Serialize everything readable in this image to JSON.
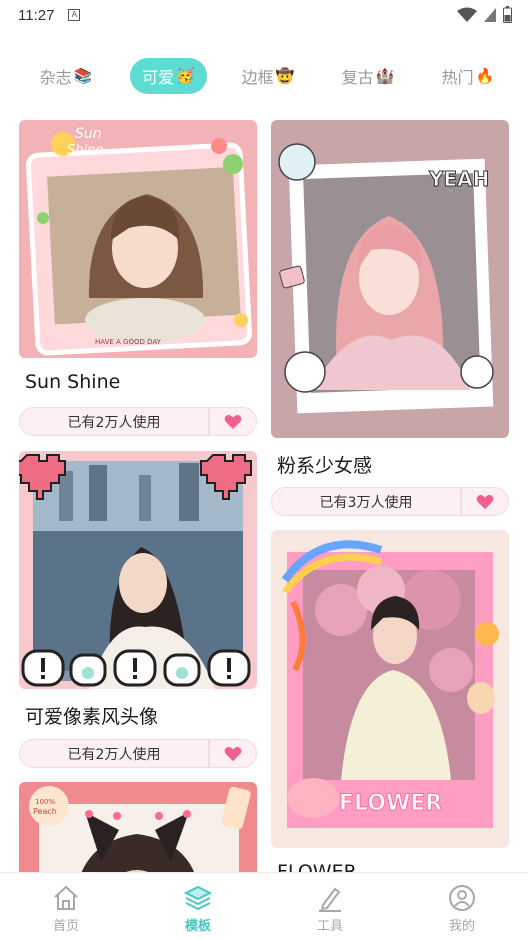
{
  "status_bar": {
    "time": "11:27",
    "notif_badge": "A"
  },
  "tabs": [
    {
      "label": "杂志",
      "emoji": "📚"
    },
    {
      "label": "可爱",
      "emoji": "🥳"
    },
    {
      "label": "边框",
      "emoji": "🤠"
    },
    {
      "label": "复古",
      "emoji": "🏰"
    },
    {
      "label": "热门",
      "emoji": "🔥"
    }
  ],
  "active_tab": "可爱",
  "cards": [
    {
      "title": "Sun Shine",
      "usage": "已有2万人使用",
      "photo_texts": [
        "Sun",
        "Shine",
        "HAVE A GOOD DAY"
      ]
    },
    {
      "title": "粉系少女感",
      "usage": "已有3万人使用",
      "photo_texts": [
        "YEAH"
      ]
    },
    {
      "title": "可爱像素风头像",
      "usage": "已有2万人使用",
      "photo_texts": []
    },
    {
      "title": "FLOWER",
      "usage": "",
      "photo_texts": [
        "FLOWER"
      ]
    },
    {
      "title": "",
      "usage": "",
      "photo_texts": [
        "100%",
        "Peach"
      ]
    }
  ],
  "bottom_nav": [
    {
      "label": "首页",
      "icon": "home-icon"
    },
    {
      "label": "模板",
      "icon": "layers-icon"
    },
    {
      "label": "工具",
      "icon": "pen-icon"
    },
    {
      "label": "我的",
      "icon": "profile-icon"
    }
  ],
  "colors": {
    "accent": "#5fdcd1",
    "nav_active": "#47c7c6",
    "like_heart": "#ef5f8f",
    "pill_bg": "#fdf0f3"
  }
}
